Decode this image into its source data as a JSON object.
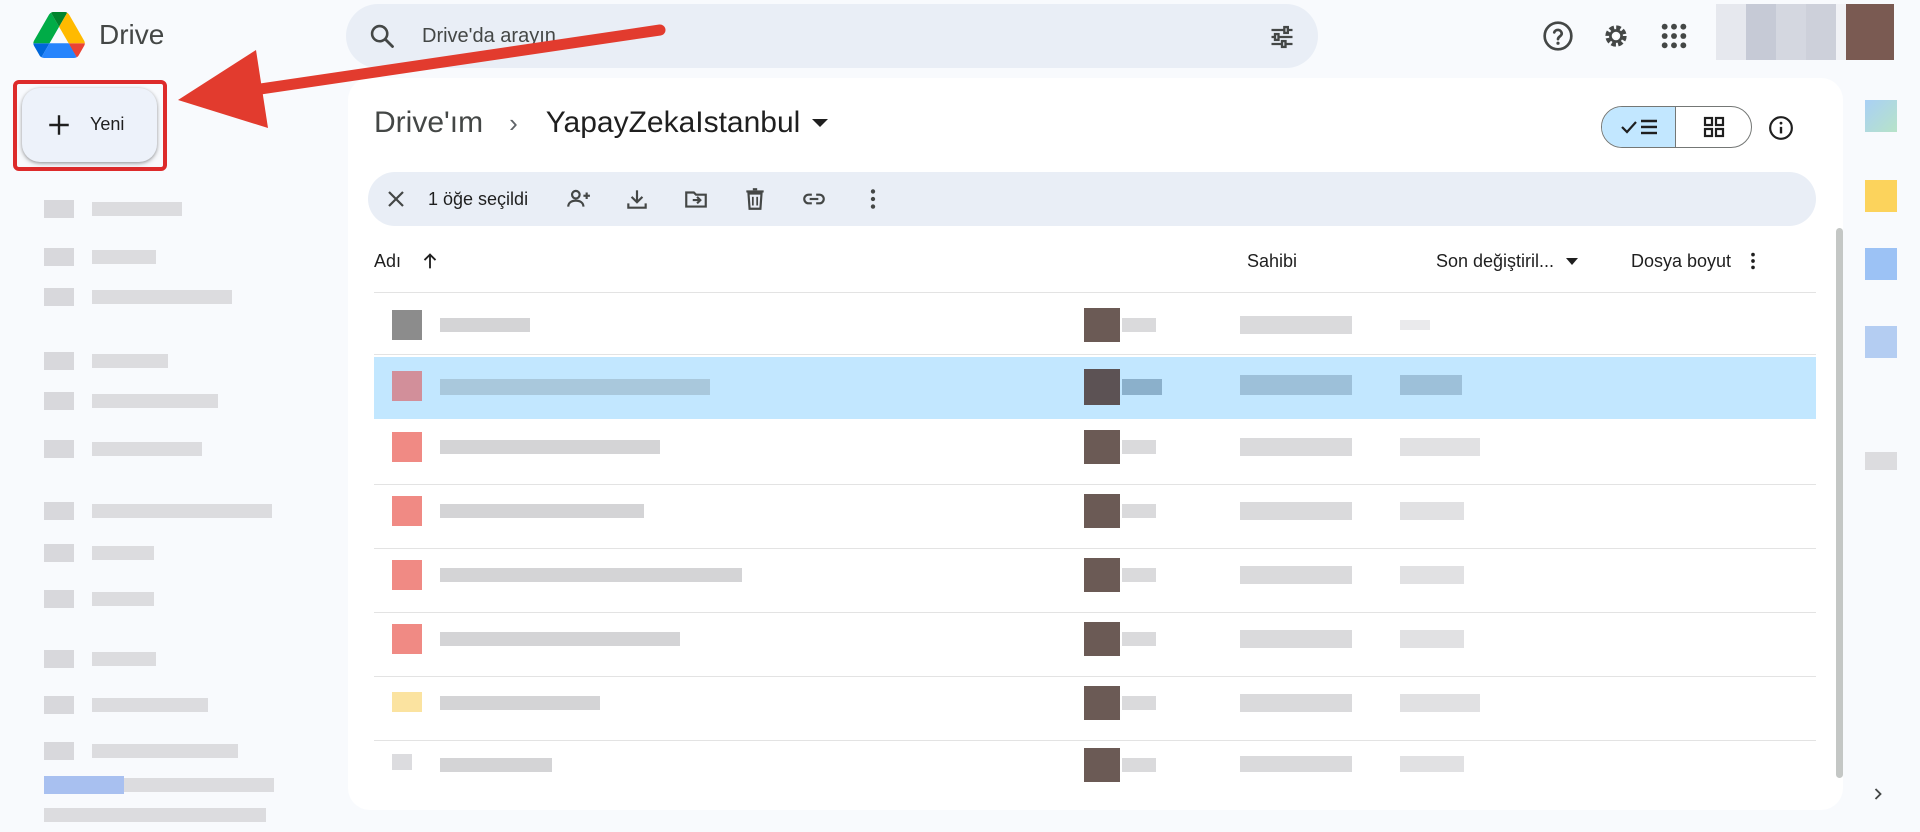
{
  "app": {
    "name": "Drive"
  },
  "search": {
    "placeholder": "Drive'da arayın"
  },
  "sidebar": {
    "new_label": "Yeni"
  },
  "breadcrumb": {
    "root": "Drive'ım",
    "separator": "›",
    "current": "YapayZekaIstanbul"
  },
  "selection_bar": {
    "count_label": "1 öğe seçildi"
  },
  "columns": {
    "name": "Adı",
    "owner": "Sahibi",
    "modified": "Son değiştiril...",
    "size": "Dosya boyut"
  },
  "colors": {
    "accent": "#c2e7ff",
    "highlight": "#dd2b2b",
    "arrow": "#e23b2e"
  }
}
